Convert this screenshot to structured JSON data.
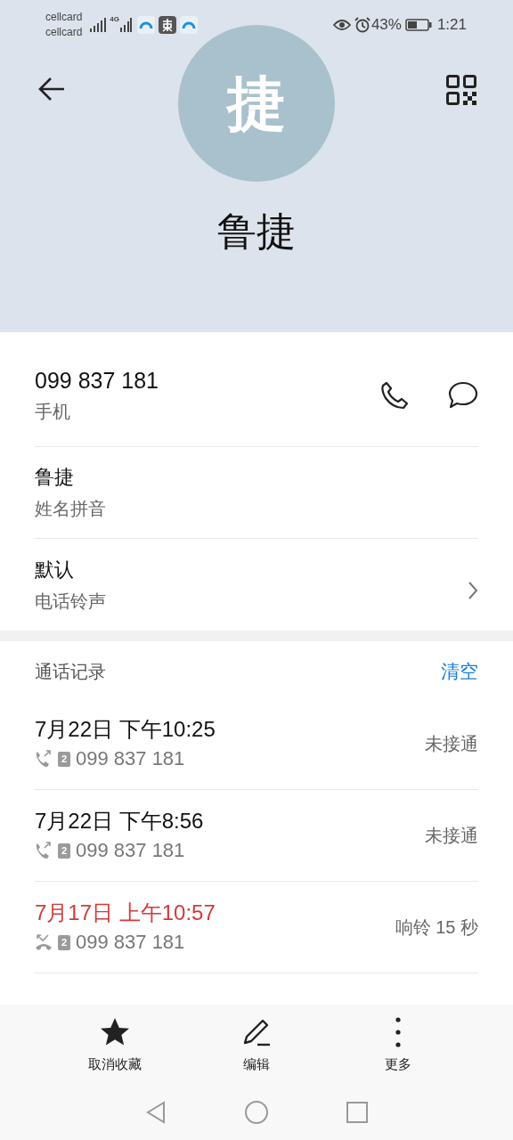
{
  "status_bar": {
    "carriers": [
      "cellcard",
      "cellcard"
    ],
    "network": "4G",
    "battery_percent": "43%",
    "time": "1:21"
  },
  "contact": {
    "avatar_letter": "捷",
    "name": "鲁捷"
  },
  "details": [
    {
      "kind": "phone",
      "value": "099 837 181",
      "label": "手机"
    },
    {
      "kind": "plain",
      "value": "鲁捷",
      "label": "姓名拼音"
    },
    {
      "kind": "link",
      "value": "默认",
      "label": "电话铃声"
    }
  ],
  "call_log": {
    "title": "通话记录",
    "clear": "清空",
    "entries": [
      {
        "kind": "outgoing",
        "when": "7月22日 下午10:25",
        "sim": "2",
        "number": "099 837 181",
        "result": "未接通"
      },
      {
        "kind": "outgoing",
        "when": "7月22日 下午8:56",
        "sim": "2",
        "number": "099 837 181",
        "result": "未接通"
      },
      {
        "kind": "missed",
        "when": "7月17日 上午10:57",
        "sim": "2",
        "number": "099 837 181",
        "result": "响铃 15 秒"
      }
    ]
  },
  "actions": [
    {
      "kind": "star",
      "label": "取消收藏"
    },
    {
      "kind": "edit",
      "label": "编辑"
    },
    {
      "kind": "more",
      "label": "更多"
    }
  ]
}
